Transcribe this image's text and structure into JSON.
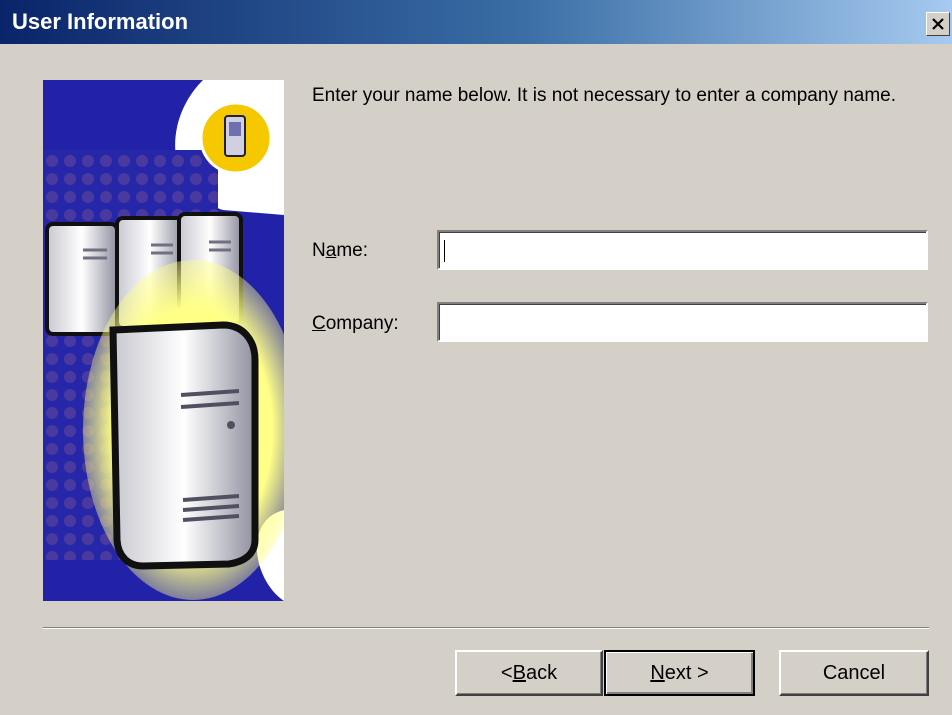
{
  "window": {
    "title": "User Information",
    "close_icon": "close-icon"
  },
  "intro_text": "Enter your name below.  It is not necessary to enter a company name.",
  "form": {
    "name": {
      "label_pre": "N",
      "label_accel": "a",
      "label_post": "me:",
      "value": ""
    },
    "company": {
      "label_pre": "",
      "label_accel": "C",
      "label_post": "ompany:",
      "value": ""
    }
  },
  "buttons": {
    "back": {
      "pre": "< ",
      "accel": "B",
      "post": "ack"
    },
    "next": {
      "pre": "",
      "accel": "N",
      "post": "ext >"
    },
    "cancel": {
      "label": "Cancel"
    }
  },
  "graphic": {
    "name": "server-wizard-graphic",
    "colors": {
      "blue": "#2a2ab8",
      "navy": "#0f0f6e",
      "gold": "#f5c800",
      "glow": "#ffff66"
    }
  }
}
